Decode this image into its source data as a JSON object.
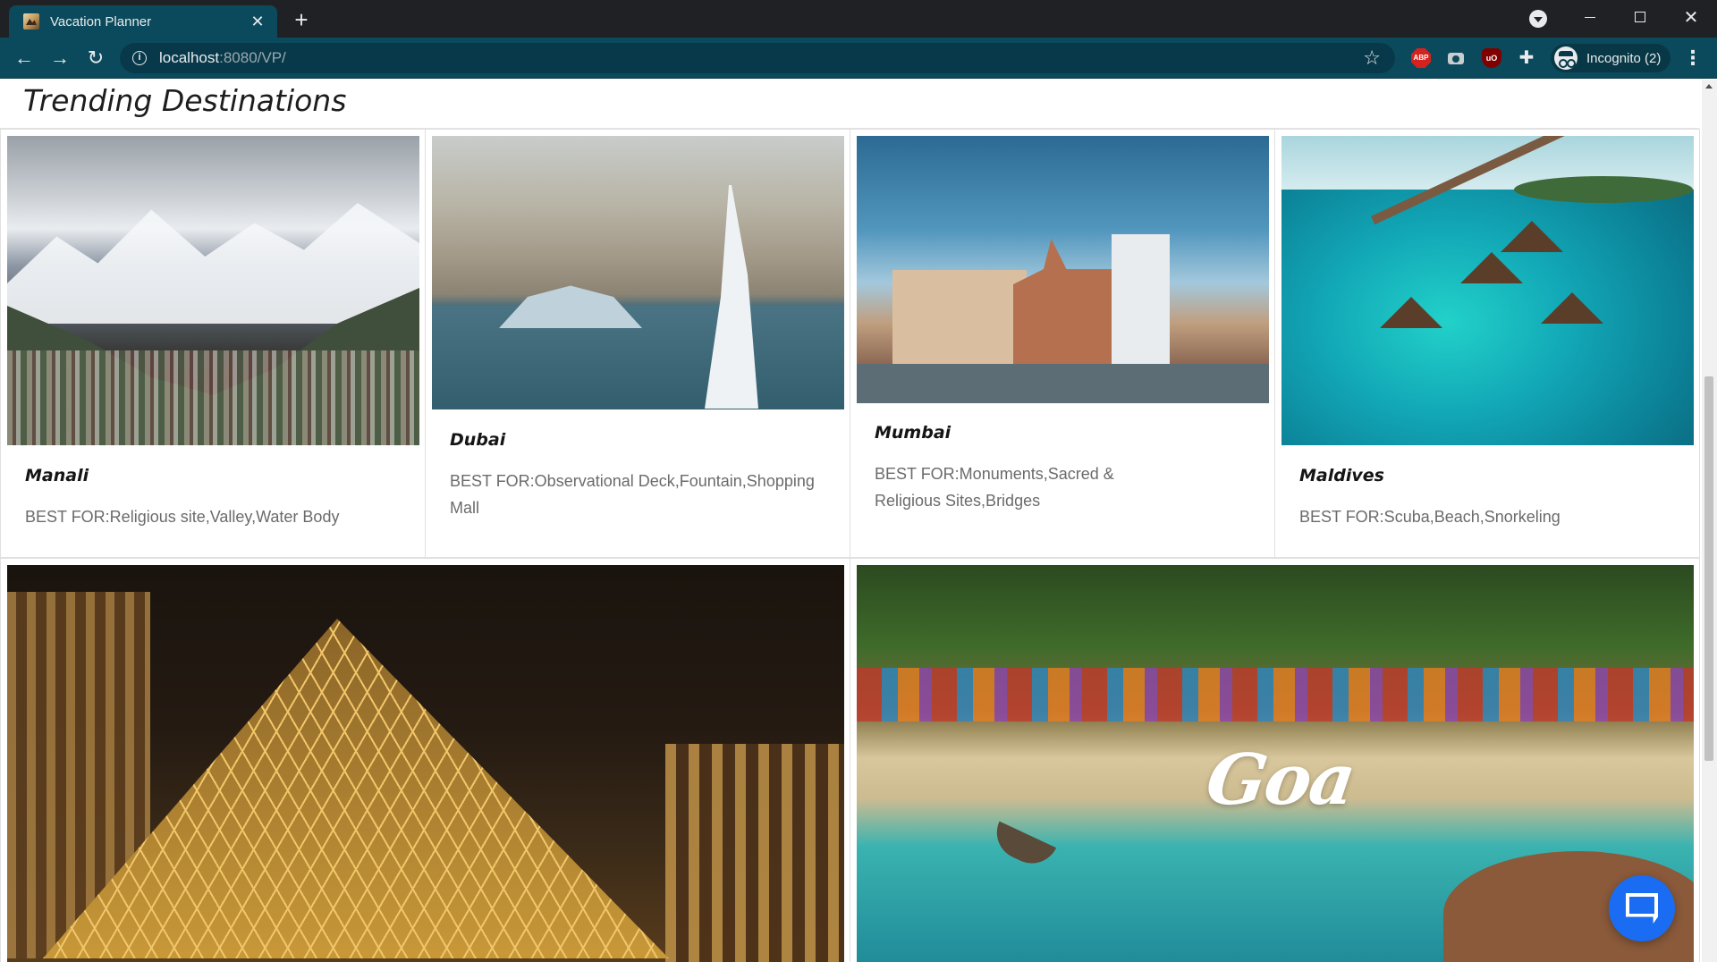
{
  "browser": {
    "tab_title": "Vacation Planner",
    "url_host": "localhost",
    "url_path": ":8080/VP/",
    "profile_label": "Incognito (2)",
    "icons": [
      "back-icon",
      "forward-icon",
      "reload-icon",
      "info-icon",
      "star-icon",
      "adblock-icon",
      "camera-icon",
      "ublock-icon",
      "puzzle-icon",
      "incognito-icon",
      "menu-icon"
    ]
  },
  "page": {
    "title": "Trending Destinations",
    "destinations": [
      {
        "name": "Manali",
        "best_for": "BEST FOR:Religious site,Valley,Water Body"
      },
      {
        "name": "Dubai",
        "best_for": "BEST FOR:Observational Deck,Fountain,Shopping Mall"
      },
      {
        "name": "Mumbai",
        "best_for": "BEST FOR:Monuments,Sacred & Religious Sites,Bridges"
      },
      {
        "name": "Maldives",
        "best_for": "BEST FOR:Scuba,Beach,Snorkeling"
      }
    ],
    "featured": [
      {
        "image_label": ""
      },
      {
        "image_label": "Goa"
      }
    ]
  },
  "colors": {
    "toolbar": "#0b4a5c",
    "titlebar": "#202124",
    "chat_button": "#1a6cf3"
  }
}
